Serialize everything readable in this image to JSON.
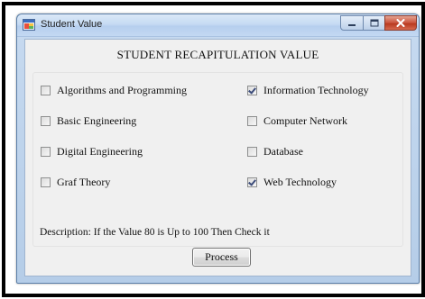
{
  "window": {
    "title": "Student Value"
  },
  "form": {
    "heading": "STUDENT RECAPITULATION VALUE",
    "left_column": [
      {
        "label": "Algorithms and Programming",
        "checked": false
      },
      {
        "label": "Basic Engineering",
        "checked": false
      },
      {
        "label": "Digital Engineering",
        "checked": false
      },
      {
        "label": "Graf Theory",
        "checked": false
      }
    ],
    "right_column": [
      {
        "label": "Information Technology",
        "checked": true
      },
      {
        "label": "Computer Network",
        "checked": false
      },
      {
        "label": "Database",
        "checked": false
      },
      {
        "label": "Web Technology",
        "checked": true
      }
    ],
    "description": "Description: If the Value 80 is Up to 100 Then Check it",
    "process_label": "Process"
  },
  "icons": {
    "app": "app-window-icon",
    "minimize": "minimize-icon",
    "maximize": "maximize-icon",
    "close": "close-icon"
  },
  "colors": {
    "close_button": "#c9513a",
    "titlebar": "#c6dbf3",
    "client_bg": "#f0f0f0"
  }
}
